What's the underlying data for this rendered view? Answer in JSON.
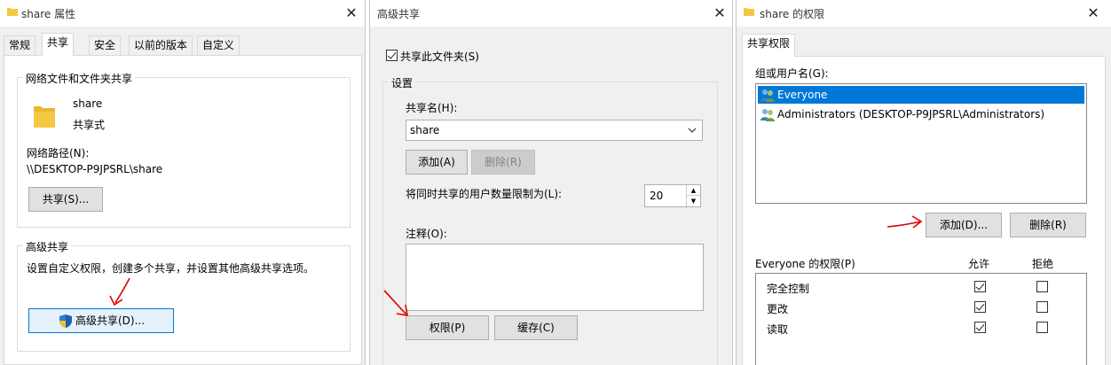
{
  "win_props": {
    "title": "share 属性",
    "tabs": [
      "常规",
      "共享",
      "安全",
      "以前的版本",
      "自定义"
    ],
    "net_group_title": "网络文件和文件夹共享",
    "folder_name": "share",
    "folder_state": "共享式",
    "path_label": "网络路径(N):",
    "path_value": "\\\\DESKTOP-P9JPSRL\\share",
    "share_btn": "共享(S)...",
    "adv_group_title": "高级共享",
    "adv_desc": "设置自定义权限，创建多个共享，并设置其他高级共享选项。",
    "adv_btn": "高级共享(D)..."
  },
  "win_adv": {
    "title": "高级共享",
    "share_checkbox": "共享此文件夹(S)",
    "settings_title": "设置",
    "share_name_label": "共享名(H):",
    "share_name_value": "share",
    "add_btn": "添加(A)",
    "remove_btn": "删除(R)",
    "limit_label": "将同时共享的用户数量限制为(L):",
    "limit_value": "20",
    "comment_label": "注释(O):",
    "perm_btn": "权限(P)",
    "cache_btn": "缓存(C)"
  },
  "win_perm": {
    "title": "share 的权限",
    "tab": "共享权限",
    "group_label": "组或用户名(G):",
    "users": [
      "Everyone",
      "Administrators (DESKTOP-P9JPSRL\\Administrators)"
    ],
    "add_btn": "添加(D)...",
    "remove_btn": "删除(R)",
    "perm_header": "Everyone 的权限(P)",
    "allow_header": "允许",
    "deny_header": "拒绝",
    "permissions": [
      {
        "name": "完全控制",
        "allow": true,
        "deny": false
      },
      {
        "name": "更改",
        "allow": true,
        "deny": false
      },
      {
        "name": "读取",
        "allow": true,
        "deny": false
      }
    ]
  },
  "colors": {
    "selection": "#0078d7",
    "annotation_arrow": "#e00000",
    "folder": "#f5c842"
  },
  "icons": {
    "folder": "folder-icon",
    "shield": "uac-shield-icon",
    "users": "users-icon",
    "close": "close-icon",
    "chevron": "chevron-down-icon"
  }
}
